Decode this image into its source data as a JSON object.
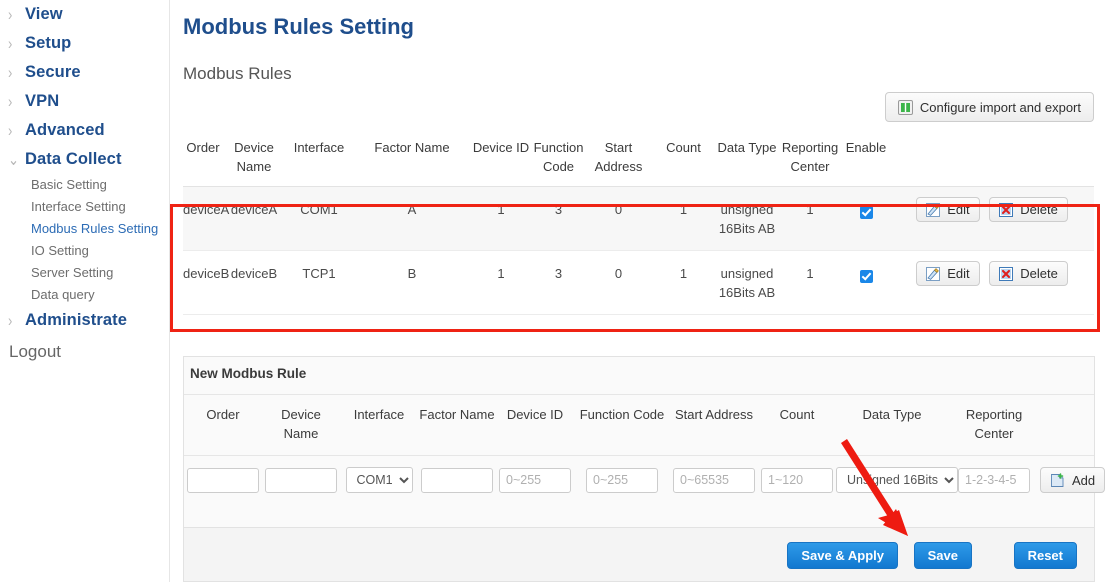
{
  "sidebar": {
    "groups": [
      {
        "label": "View",
        "icon": "chevron-right-icon",
        "expanded": false
      },
      {
        "label": "Setup",
        "icon": "chevron-right-icon",
        "expanded": false
      },
      {
        "label": "Secure",
        "icon": "chevron-right-icon",
        "expanded": false
      },
      {
        "label": "VPN",
        "icon": "chevron-right-icon",
        "expanded": false
      },
      {
        "label": "Advanced",
        "icon": "chevron-right-icon",
        "expanded": false
      },
      {
        "label": "Data Collect",
        "icon": "chevron-down-icon",
        "expanded": true
      },
      {
        "label": "Administrate",
        "icon": "chevron-right-icon",
        "expanded": false
      }
    ],
    "subitems": [
      {
        "label": "Basic Setting",
        "active": false
      },
      {
        "label": "Interface Setting",
        "active": false
      },
      {
        "label": "Modbus Rules Setting",
        "active": true
      },
      {
        "label": "IO Setting",
        "active": false
      },
      {
        "label": "Server Setting",
        "active": false
      },
      {
        "label": "Data query",
        "active": false
      }
    ],
    "logout": "Logout"
  },
  "main": {
    "title": "Modbus Rules Setting",
    "subtitle": "Modbus Rules",
    "import_export_button": "Configure import and export",
    "import_export_icon": "import-export-icon"
  },
  "rules_table": {
    "headers": [
      "Order",
      "Device Name",
      "Interface",
      "Factor Name",
      "Device ID",
      "Function Code",
      "Start Address",
      "Count",
      "Data Type",
      "Reporting Center",
      "Enable",
      ""
    ],
    "rows": [
      {
        "order": "deviceA",
        "device_name": "deviceA",
        "interface": "COM1",
        "factor_name": "A",
        "device_id": "1",
        "function_code": "3",
        "start_address": "0",
        "count": "1",
        "data_type": "unsigned 16Bits AB",
        "reporting_center": "1",
        "enable": true,
        "edit_label": "Edit",
        "delete_label": "Delete"
      },
      {
        "order": "deviceB",
        "device_name": "deviceB",
        "interface": "TCP1",
        "factor_name": "B",
        "device_id": "1",
        "function_code": "3",
        "start_address": "0",
        "count": "1",
        "data_type": "unsigned 16Bits AB",
        "reporting_center": "1",
        "enable": true,
        "edit_label": "Edit",
        "delete_label": "Delete"
      }
    ]
  },
  "new_rule": {
    "panel_title": "New Modbus Rule",
    "headers": [
      "Order",
      "Device Name",
      "Interface",
      "Factor Name",
      "Device ID",
      "Function Code",
      "Start Address",
      "Count",
      "Data Type",
      "Reporting Center",
      ""
    ],
    "fields": {
      "order": {
        "value": "",
        "placeholder": ""
      },
      "device_name": {
        "value": "",
        "placeholder": ""
      },
      "interface": {
        "selected": "COM1",
        "options": [
          "COM1"
        ]
      },
      "factor_name": {
        "value": "",
        "placeholder": ""
      },
      "device_id": {
        "value": "",
        "placeholder": "0~255"
      },
      "function_code": {
        "value": "",
        "placeholder": "0~255"
      },
      "start_address": {
        "value": "",
        "placeholder": "0~65535"
      },
      "count": {
        "value": "",
        "placeholder": "1~120"
      },
      "data_type": {
        "selected": "Unsigned 16Bits",
        "options": [
          "Unsigned 16Bits"
        ]
      },
      "reporting_center": {
        "value": "",
        "placeholder": "1-2-3-4-5"
      }
    },
    "add_button": "Add",
    "add_icon": "add-page-icon"
  },
  "footer": {
    "save_apply_label": "Save & Apply",
    "save_label": "Save",
    "reset_label": "Reset"
  },
  "annotations": {
    "highlight_box_color": "#ef2314",
    "arrow_color": "#ee1b11"
  },
  "colors": {
    "nav_blue": "#1f4e8c",
    "link_blue": "#2d6cb5",
    "primary_button": "#1278d0",
    "checkbox_blue": "#1a87e8"
  }
}
